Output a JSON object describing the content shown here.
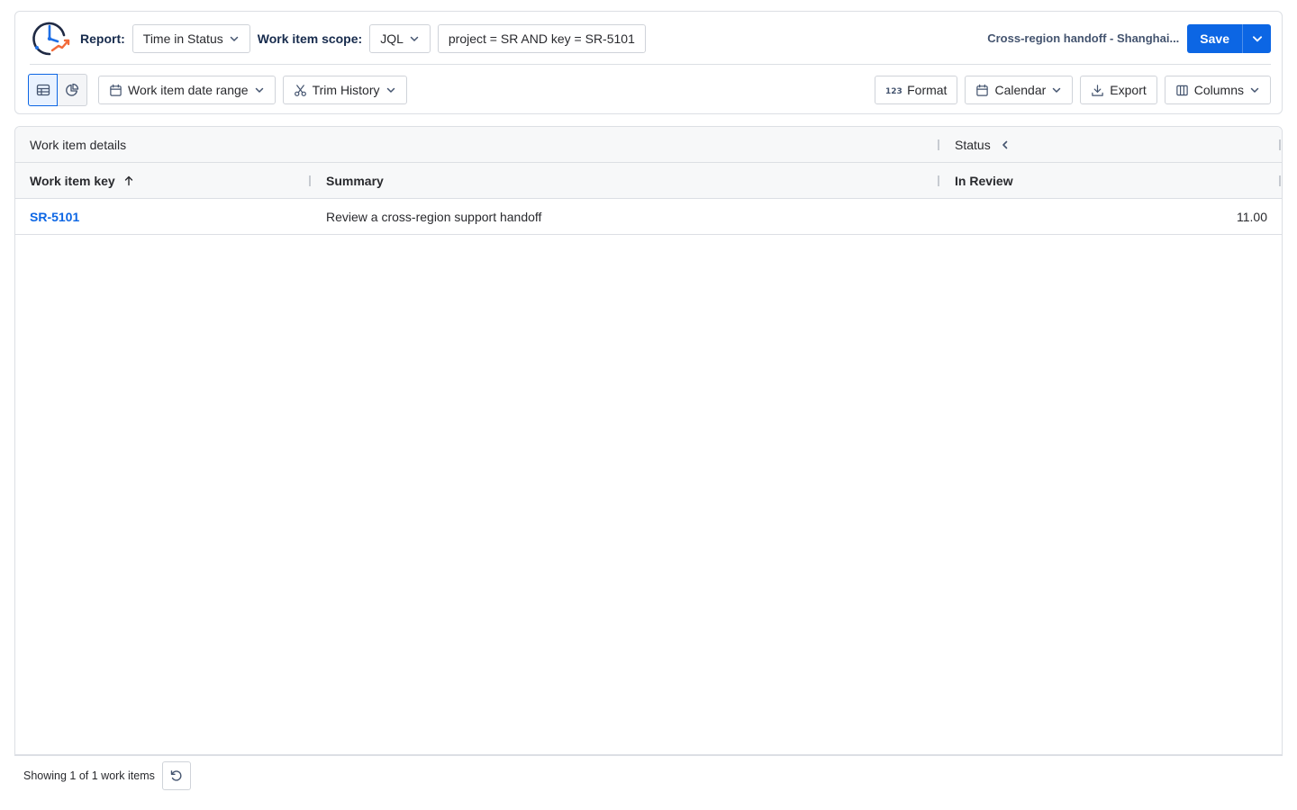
{
  "toolbar": {
    "report_label": "Report:",
    "report_value": "Time in Status",
    "scope_label": "Work item scope:",
    "scope_value": "JQL",
    "jql_query": "project = SR AND key = SR-5101",
    "report_name": "Cross-region handoff - Shanghai...",
    "save_label": "Save",
    "date_range_label": "Work item date range",
    "trim_history_label": "Trim History",
    "format_label": "Format",
    "calendar_label": "Calendar",
    "export_label": "Export",
    "columns_label": "Columns"
  },
  "table": {
    "group_headers": {
      "details": "Work item details",
      "status": "Status"
    },
    "columns": {
      "key": "Work item key",
      "summary": "Summary",
      "in_review": "In Review"
    },
    "sort": "ascending",
    "rows": [
      {
        "key": "SR-5101",
        "summary": "Review a cross-region support handoff",
        "in_review": "11.00"
      }
    ]
  },
  "footer": {
    "showing": "Showing 1 of 1 work items"
  },
  "colors": {
    "accent": "#0c66e4",
    "border": "#dcdfe4",
    "header_bg": "#f7f8f9",
    "text": "#292a2e"
  },
  "icons": [
    "app-logo-clock-icon",
    "chevron-down-icon",
    "table-view-icon",
    "pie-chart-icon",
    "calendar-icon",
    "scissors-icon",
    "format-123-icon",
    "download-icon",
    "columns-icon",
    "arrow-up-icon",
    "chevron-left-icon",
    "refresh-icon"
  ]
}
